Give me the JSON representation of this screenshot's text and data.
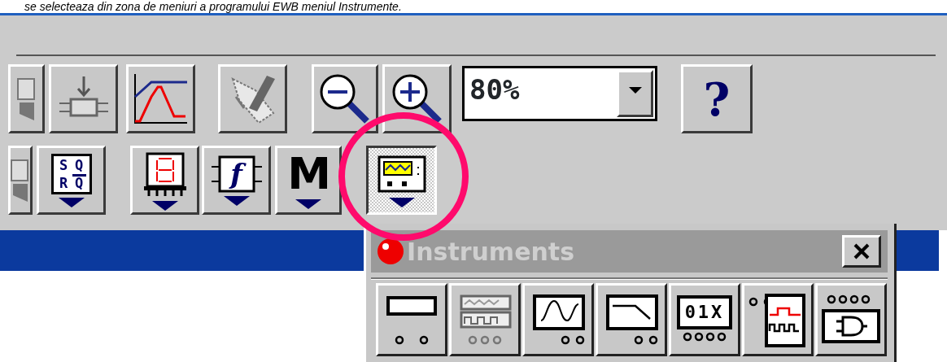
{
  "caption": "se selecteaza din zona de meniuri a programului EWB meniul Instrumente.",
  "toolbar": {
    "row_1": [
      {
        "kind": "partial"
      },
      {
        "kind": "component"
      },
      {
        "kind": "analysis"
      },
      {
        "kind": "check"
      },
      {
        "kind": "zoom_out"
      },
      {
        "kind": "zoom_in"
      },
      {
        "kind": "zoom_combo",
        "value": "80%"
      },
      {
        "kind": "help",
        "label": "?"
      }
    ],
    "row_2": [
      {
        "kind": "partial",
        "selected": false
      },
      {
        "kind": "flipflop",
        "labels": [
          {
            "text": "S",
            "bar": false
          },
          {
            "text": "Q",
            "bar": false
          },
          {
            "text": "R",
            "bar": false
          },
          {
            "text": "Q",
            "bar": true
          }
        ],
        "selected": false
      },
      {
        "kind": "display",
        "selected": false
      },
      {
        "kind": "function",
        "label": "f",
        "selected": false
      },
      {
        "kind": "misc",
        "label": "M",
        "selected": false
      },
      {
        "kind": "instruments",
        "selected": true
      }
    ]
  },
  "annotation": {
    "kind": "circle"
  },
  "instruments_palette": {
    "title": "Instruments",
    "tools": [
      {
        "kind": "multimeter"
      },
      {
        "kind": "function_generator"
      },
      {
        "kind": "oscilloscope"
      },
      {
        "kind": "bode_plotter"
      },
      {
        "kind": "word_generator",
        "label": "01X"
      },
      {
        "kind": "logic_analyzer"
      },
      {
        "kind": "logic_converter"
      }
    ]
  }
}
